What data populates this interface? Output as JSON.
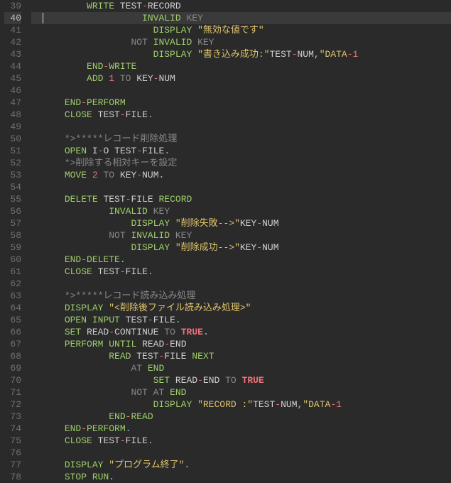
{
  "lines": [
    {
      "n": 39,
      "ind": 7,
      "tokens": [
        [
          "kw",
          "WRITE"
        ],
        [
          "sp",
          " "
        ],
        [
          "id",
          "TEST"
        ],
        [
          "minus",
          "-"
        ],
        [
          "id",
          "RECORD"
        ]
      ]
    },
    {
      "n": 40,
      "hl": true,
      "cursor": true,
      "ind": 11,
      "tokens": [
        [
          "kw",
          "INVALID"
        ],
        [
          "sp",
          " "
        ],
        [
          "kw2",
          "KEY"
        ]
      ]
    },
    {
      "n": 41,
      "ind": 13,
      "tokens": [
        [
          "kw",
          "DISPLAY"
        ],
        [
          "sp",
          " "
        ],
        [
          "str",
          "\"無効な値です\""
        ]
      ]
    },
    {
      "n": 42,
      "ind": 11,
      "tokens": [
        [
          "kw2",
          "NOT"
        ],
        [
          "sp",
          " "
        ],
        [
          "kw",
          "INVALID"
        ],
        [
          "sp",
          " "
        ],
        [
          "kw2",
          "KEY"
        ]
      ]
    },
    {
      "n": 43,
      "ind": 13,
      "tokens": [
        [
          "kw",
          "DISPLAY"
        ],
        [
          "sp",
          " "
        ],
        [
          "str",
          "\"書き込み成功:\""
        ],
        [
          "id",
          "TEST"
        ],
        [
          "minus",
          "-"
        ],
        [
          "id",
          "NUM"
        ],
        [
          "dot",
          ","
        ],
        [
          "str",
          "\"DATA"
        ],
        [
          "str-op",
          "-"
        ],
        [
          "num",
          "1"
        ]
      ]
    },
    {
      "n": 44,
      "ind": 7,
      "tokens": [
        [
          "kw",
          "END"
        ],
        [
          "minus",
          "-"
        ],
        [
          "kw",
          "WRITE"
        ]
      ]
    },
    {
      "n": 45,
      "ind": 7,
      "tokens": [
        [
          "kw",
          "ADD"
        ],
        [
          "sp",
          " "
        ],
        [
          "num",
          "1"
        ],
        [
          "sp",
          " "
        ],
        [
          "kw2",
          "TO"
        ],
        [
          "sp",
          " "
        ],
        [
          "id",
          "KEY"
        ],
        [
          "minus",
          "-"
        ],
        [
          "id",
          "NUM"
        ]
      ]
    },
    {
      "n": 46,
      "ind": 0,
      "tokens": []
    },
    {
      "n": 47,
      "ind": 5,
      "tokens": [
        [
          "kw",
          "END"
        ],
        [
          "minus",
          "-"
        ],
        [
          "kw",
          "PERFORM"
        ]
      ]
    },
    {
      "n": 48,
      "ind": 5,
      "tokens": [
        [
          "kw",
          "CLOSE"
        ],
        [
          "sp",
          " "
        ],
        [
          "id",
          "TEST"
        ],
        [
          "minus",
          "-"
        ],
        [
          "id",
          "FILE"
        ],
        [
          "dot",
          "."
        ]
      ]
    },
    {
      "n": 49,
      "ind": 0,
      "tokens": []
    },
    {
      "n": 50,
      "ind": 5,
      "tokens": [
        [
          "cmt",
          "*>*****レコード削除処理"
        ]
      ]
    },
    {
      "n": 51,
      "ind": 5,
      "tokens": [
        [
          "kw",
          "OPEN"
        ],
        [
          "sp",
          " "
        ],
        [
          "io",
          "I"
        ],
        [
          "minus",
          "-"
        ],
        [
          "io",
          "O"
        ],
        [
          "sp",
          " "
        ],
        [
          "id",
          "TEST"
        ],
        [
          "minus",
          "-"
        ],
        [
          "id",
          "FILE"
        ],
        [
          "dot",
          "."
        ]
      ]
    },
    {
      "n": 52,
      "ind": 5,
      "tokens": [
        [
          "cmt",
          "*>削除する相対キーを設定"
        ]
      ]
    },
    {
      "n": 53,
      "ind": 5,
      "tokens": [
        [
          "kw",
          "MOVE"
        ],
        [
          "sp",
          " "
        ],
        [
          "num",
          "2"
        ],
        [
          "sp",
          " "
        ],
        [
          "kw2",
          "TO"
        ],
        [
          "sp",
          " "
        ],
        [
          "id",
          "KEY"
        ],
        [
          "minus",
          "-"
        ],
        [
          "id",
          "NUM"
        ],
        [
          "dot",
          "."
        ]
      ]
    },
    {
      "n": 54,
      "ind": 0,
      "tokens": []
    },
    {
      "n": 55,
      "ind": 5,
      "tokens": [
        [
          "kw",
          "DELETE"
        ],
        [
          "sp",
          " "
        ],
        [
          "id",
          "TEST"
        ],
        [
          "minus",
          "-"
        ],
        [
          "id",
          "FILE"
        ],
        [
          "sp",
          " "
        ],
        [
          "kw",
          "RECORD"
        ]
      ]
    },
    {
      "n": 56,
      "ind": 9,
      "tokens": [
        [
          "kw",
          "INVALID"
        ],
        [
          "sp",
          " "
        ],
        [
          "kw2",
          "KEY"
        ]
      ]
    },
    {
      "n": 57,
      "ind": 11,
      "tokens": [
        [
          "kw",
          "DISPLAY"
        ],
        [
          "sp",
          " "
        ],
        [
          "str",
          "\"削除失敗-->\""
        ],
        [
          "id",
          "KEY"
        ],
        [
          "minus",
          "-"
        ],
        [
          "id",
          "NUM"
        ]
      ]
    },
    {
      "n": 58,
      "ind": 9,
      "tokens": [
        [
          "kw2",
          "NOT"
        ],
        [
          "sp",
          " "
        ],
        [
          "kw",
          "INVALID"
        ],
        [
          "sp",
          " "
        ],
        [
          "kw2",
          "KEY"
        ]
      ]
    },
    {
      "n": 59,
      "ind": 11,
      "tokens": [
        [
          "kw",
          "DISPLAY"
        ],
        [
          "sp",
          " "
        ],
        [
          "str",
          "\"削除成功-->\""
        ],
        [
          "id",
          "KEY"
        ],
        [
          "minus",
          "-"
        ],
        [
          "id",
          "NUM"
        ]
      ]
    },
    {
      "n": 60,
      "ind": 5,
      "tokens": [
        [
          "kw",
          "END"
        ],
        [
          "minus",
          "-"
        ],
        [
          "kw",
          "DELETE"
        ],
        [
          "dot",
          "."
        ]
      ]
    },
    {
      "n": 61,
      "ind": 5,
      "tokens": [
        [
          "kw",
          "CLOSE"
        ],
        [
          "sp",
          " "
        ],
        [
          "id",
          "TEST"
        ],
        [
          "minus",
          "-"
        ],
        [
          "id",
          "FILE"
        ],
        [
          "dot",
          "."
        ]
      ]
    },
    {
      "n": 62,
      "ind": 0,
      "tokens": []
    },
    {
      "n": 63,
      "ind": 5,
      "tokens": [
        [
          "cmt",
          "*>*****レコード読み込み処理"
        ]
      ]
    },
    {
      "n": 64,
      "ind": 5,
      "tokens": [
        [
          "kw",
          "DISPLAY"
        ],
        [
          "sp",
          " "
        ],
        [
          "str",
          "\"<削除後ファイル読み込み処理>\""
        ]
      ]
    },
    {
      "n": 65,
      "ind": 5,
      "tokens": [
        [
          "kw",
          "OPEN"
        ],
        [
          "sp",
          " "
        ],
        [
          "kw",
          "INPUT"
        ],
        [
          "sp",
          " "
        ],
        [
          "id",
          "TEST"
        ],
        [
          "minus",
          "-"
        ],
        [
          "id",
          "FILE"
        ],
        [
          "dot",
          "."
        ]
      ]
    },
    {
      "n": 66,
      "ind": 5,
      "tokens": [
        [
          "kw",
          "SET"
        ],
        [
          "sp",
          " "
        ],
        [
          "id",
          "READ"
        ],
        [
          "minus",
          "-"
        ],
        [
          "id",
          "CONTINUE"
        ],
        [
          "sp",
          " "
        ],
        [
          "kw2",
          "TO"
        ],
        [
          "sp",
          " "
        ],
        [
          "bool",
          "TRUE"
        ],
        [
          "dot",
          "."
        ]
      ]
    },
    {
      "n": 67,
      "ind": 5,
      "tokens": [
        [
          "kw",
          "PERFORM"
        ],
        [
          "sp",
          " "
        ],
        [
          "kw",
          "UNTIL"
        ],
        [
          "sp",
          " "
        ],
        [
          "id",
          "READ"
        ],
        [
          "minus",
          "-"
        ],
        [
          "id",
          "END"
        ]
      ]
    },
    {
      "n": 68,
      "ind": 9,
      "tokens": [
        [
          "kw",
          "READ"
        ],
        [
          "sp",
          " "
        ],
        [
          "id",
          "TEST"
        ],
        [
          "minus",
          "-"
        ],
        [
          "id",
          "FILE"
        ],
        [
          "sp",
          " "
        ],
        [
          "kw",
          "NEXT"
        ]
      ]
    },
    {
      "n": 69,
      "ind": 11,
      "tokens": [
        [
          "kw2",
          "AT"
        ],
        [
          "sp",
          " "
        ],
        [
          "kw",
          "END"
        ]
      ]
    },
    {
      "n": 70,
      "ind": 13,
      "tokens": [
        [
          "kw",
          "SET"
        ],
        [
          "sp",
          " "
        ],
        [
          "id",
          "READ"
        ],
        [
          "minus",
          "-"
        ],
        [
          "id",
          "END"
        ],
        [
          "sp",
          " "
        ],
        [
          "kw2",
          "TO"
        ],
        [
          "sp",
          " "
        ],
        [
          "bool",
          "TRUE"
        ]
      ]
    },
    {
      "n": 71,
      "ind": 11,
      "tokens": [
        [
          "kw2",
          "NOT"
        ],
        [
          "sp",
          " "
        ],
        [
          "kw2",
          "AT"
        ],
        [
          "sp",
          " "
        ],
        [
          "kw",
          "END"
        ]
      ]
    },
    {
      "n": 72,
      "ind": 13,
      "tokens": [
        [
          "kw",
          "DISPLAY"
        ],
        [
          "sp",
          " "
        ],
        [
          "str",
          "\"RECORD :\""
        ],
        [
          "id",
          "TEST"
        ],
        [
          "minus",
          "-"
        ],
        [
          "id",
          "NUM"
        ],
        [
          "dot",
          ","
        ],
        [
          "str",
          "\"DATA"
        ],
        [
          "str-op",
          "-"
        ],
        [
          "num",
          "1"
        ]
      ]
    },
    {
      "n": 73,
      "ind": 9,
      "tokens": [
        [
          "kw",
          "END"
        ],
        [
          "minus",
          "-"
        ],
        [
          "kw",
          "READ"
        ]
      ]
    },
    {
      "n": 74,
      "ind": 5,
      "tokens": [
        [
          "kw",
          "END"
        ],
        [
          "minus",
          "-"
        ],
        [
          "kw",
          "PERFORM"
        ],
        [
          "dot",
          "."
        ]
      ]
    },
    {
      "n": 75,
      "ind": 5,
      "tokens": [
        [
          "kw",
          "CLOSE"
        ],
        [
          "sp",
          " "
        ],
        [
          "id",
          "TEST"
        ],
        [
          "minus",
          "-"
        ],
        [
          "id",
          "FILE"
        ],
        [
          "dot",
          "."
        ]
      ]
    },
    {
      "n": 76,
      "ind": 0,
      "tokens": []
    },
    {
      "n": 77,
      "ind": 5,
      "tokens": [
        [
          "kw",
          "DISPLAY"
        ],
        [
          "sp",
          " "
        ],
        [
          "str",
          "\"プログラム終了\""
        ],
        [
          "dot",
          "."
        ]
      ]
    },
    {
      "n": 78,
      "ind": 5,
      "tokens": [
        [
          "kw",
          "STOP"
        ],
        [
          "sp",
          " "
        ],
        [
          "kw",
          "RUN"
        ],
        [
          "dot",
          "."
        ]
      ]
    }
  ]
}
